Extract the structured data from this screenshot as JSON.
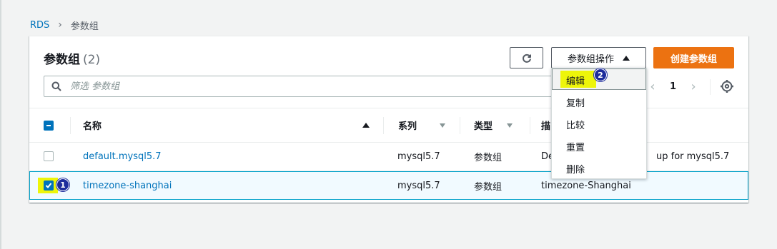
{
  "breadcrumb": {
    "root": "RDS",
    "current": "参数组"
  },
  "panel": {
    "title": "参数组",
    "count": "(2)"
  },
  "toolbar": {
    "refresh_icon": "refresh-icon",
    "actions_label": "参数组操作",
    "create_label": "创建参数组"
  },
  "search": {
    "placeholder": "筛选 参数组"
  },
  "pagination": {
    "current_page": "1"
  },
  "table": {
    "headers": {
      "name": "名称",
      "family": "系列",
      "type": "类型",
      "description": "描"
    },
    "rows": [
      {
        "name": "default.mysql5.7",
        "family": "mysql5.7",
        "type": "参数组",
        "description": "De",
        "description_tail": "up for mysql5.7",
        "selected": false
      },
      {
        "name": "timezone-shanghai",
        "family": "mysql5.7",
        "type": "参数组",
        "description": "timezone-Shanghai",
        "selected": true
      }
    ]
  },
  "dropdown": {
    "items": [
      "编辑",
      "复制",
      "比较",
      "重置",
      "删除"
    ]
  },
  "annotations": {
    "step1": "1",
    "step2": "2"
  },
  "colors": {
    "accent": "#0073bb",
    "primary_button": "#ec7211",
    "highlight": "#eef50a",
    "step_badge": "#1d2c9c"
  }
}
